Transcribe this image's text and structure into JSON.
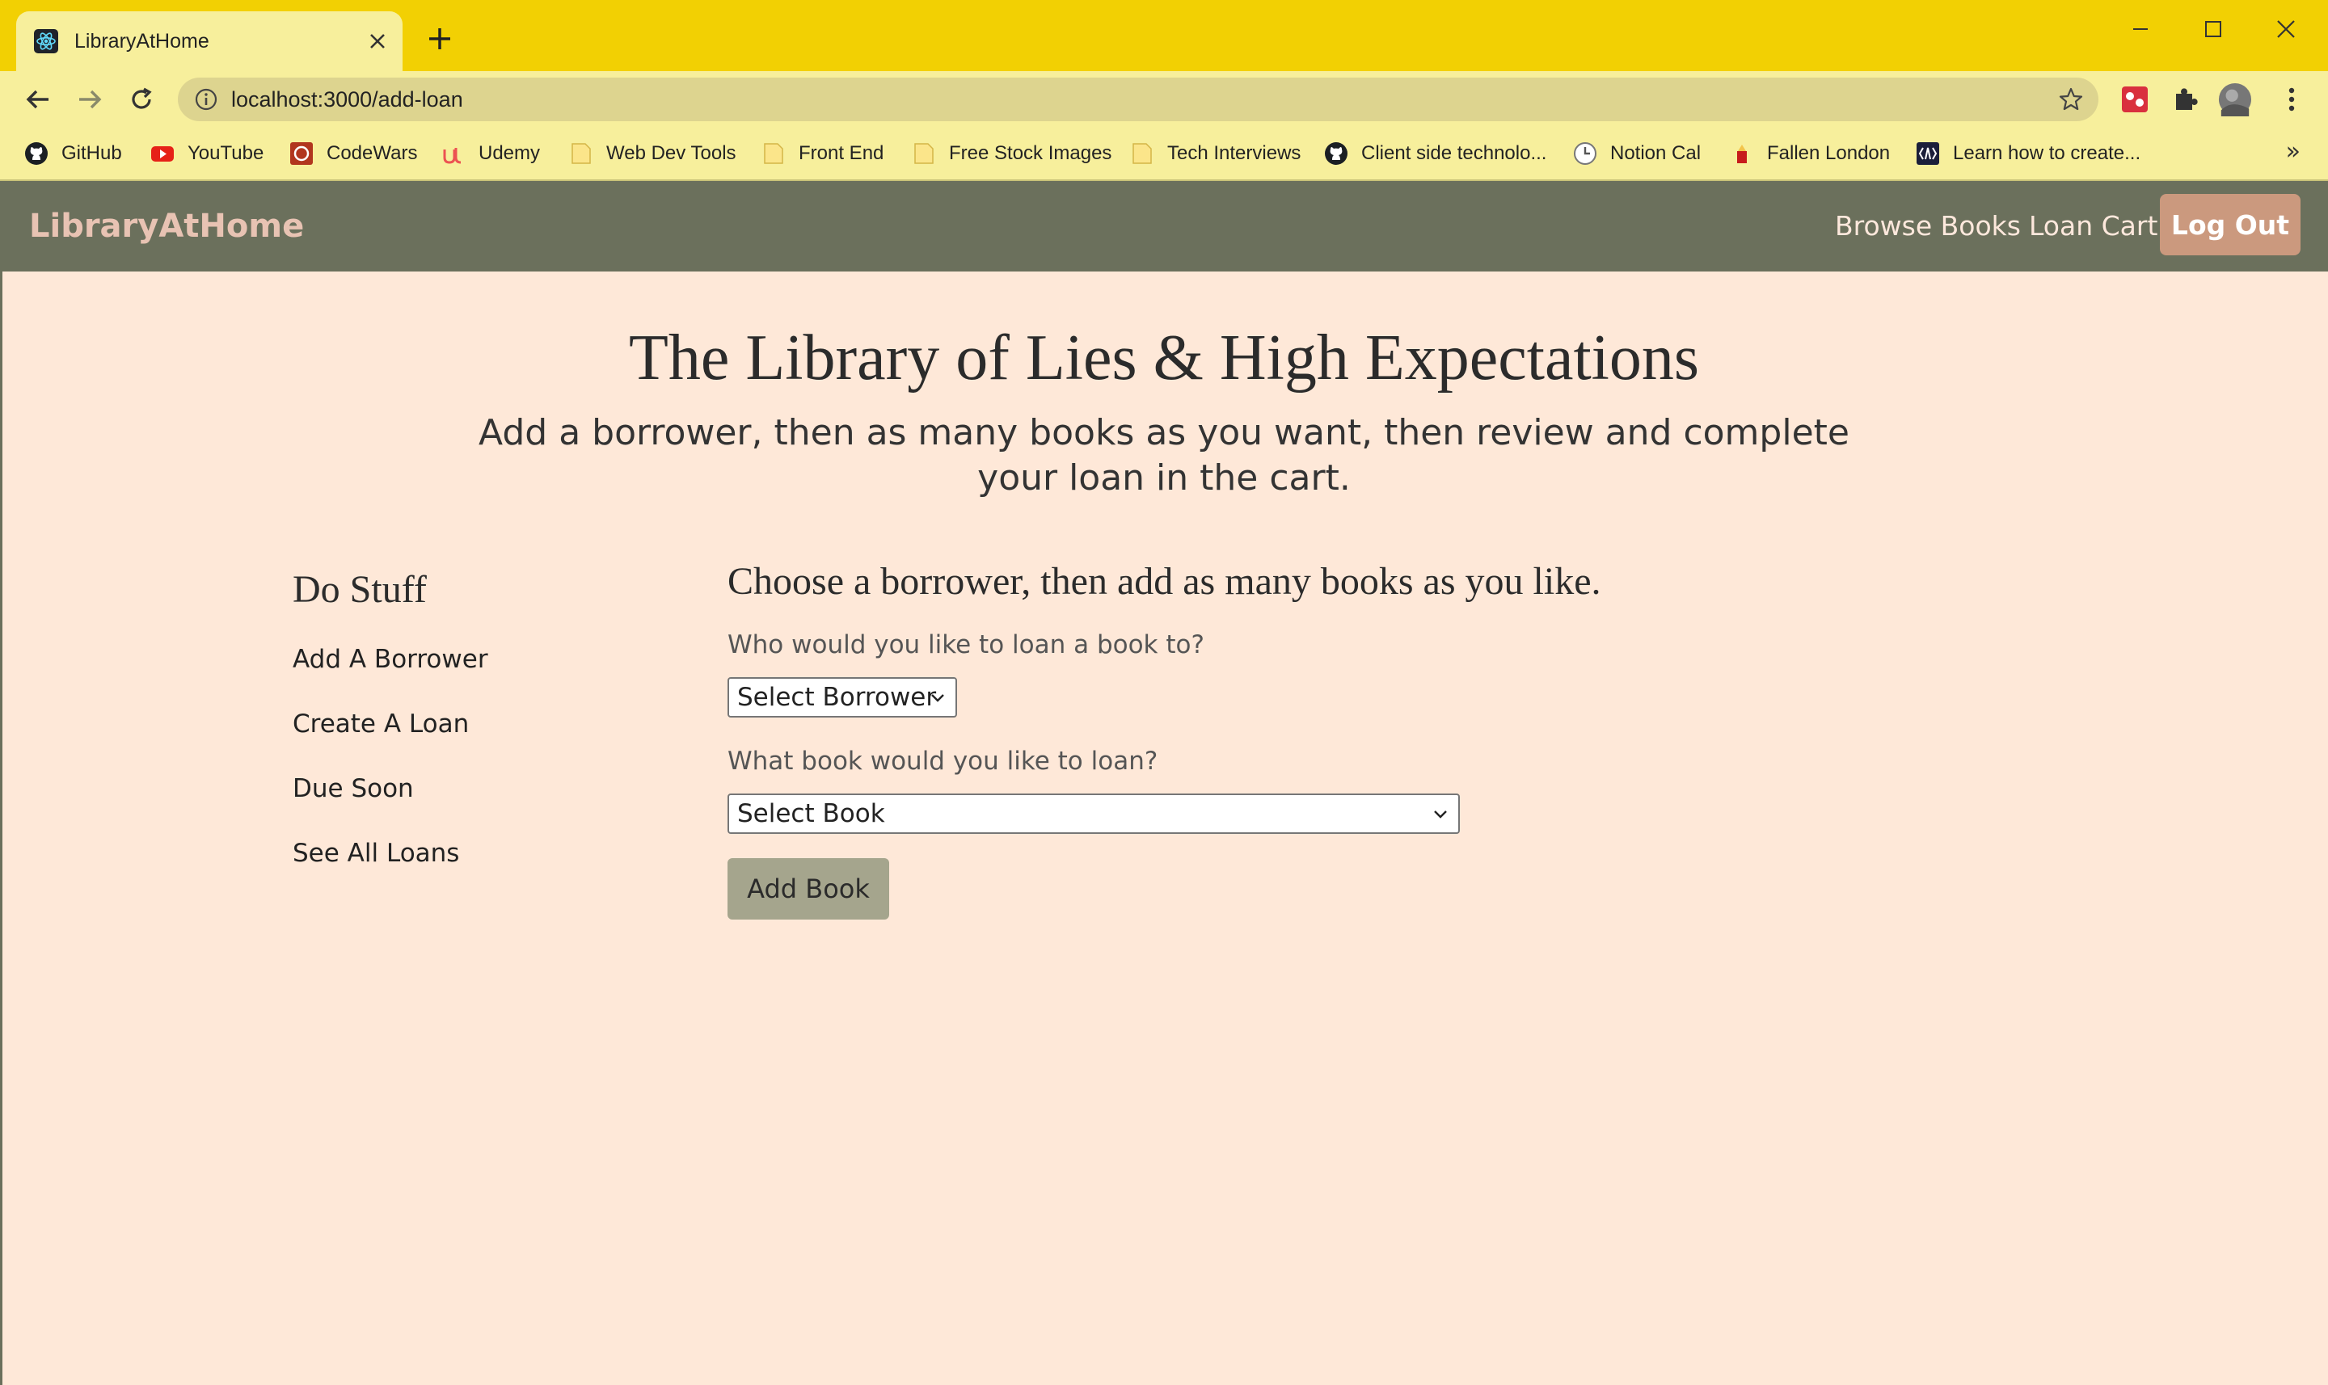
{
  "browser": {
    "tab_title": "LibraryAtHome",
    "url": "localhost:3000/add-loan",
    "bookmarks": [
      {
        "label": "GitHub",
        "icon": "github-icon"
      },
      {
        "label": "YouTube",
        "icon": "youtube-icon"
      },
      {
        "label": "CodeWars",
        "icon": "codewars-icon"
      },
      {
        "label": "Udemy",
        "icon": "udemy-icon"
      },
      {
        "label": "Web Dev Tools",
        "icon": "folder-icon"
      },
      {
        "label": "Front End",
        "icon": "folder-icon"
      },
      {
        "label": "Free Stock Images",
        "icon": "folder-icon"
      },
      {
        "label": "Tech Interviews",
        "icon": "folder-icon"
      },
      {
        "label": "Client side technolo...",
        "icon": "github-icon"
      },
      {
        "label": "Notion Cal",
        "icon": "clock-icon"
      },
      {
        "label": "Fallen London",
        "icon": "fallen-london-icon"
      },
      {
        "label": "Learn how to create...",
        "icon": "learn-icon"
      }
    ],
    "bookmarks_more": "»"
  },
  "navbar": {
    "brand": "LibraryAtHome",
    "links": [
      "Browse Books",
      "Loan Cart"
    ],
    "logout_label": "Log Out"
  },
  "main": {
    "title": "The Library of Lies & High Expectations",
    "subtitle": "Add a borrower, then as many books as you want, then review and complete your loan in the cart."
  },
  "sidebar": {
    "title": "Do Stuff",
    "items": [
      "Add A Borrower",
      "Create A Loan",
      "Due Soon",
      "See All Loans"
    ]
  },
  "form": {
    "title": "Choose a borrower, then add as many books as you like.",
    "borrower_label": "Who would you like to loan a book to?",
    "borrower_select": "Select Borrower",
    "book_label": "What book would you like to loan?",
    "book_select": "Select Book",
    "add_button": "Add Book"
  },
  "colors": {
    "browser_frame": "#f2d003",
    "navbar": "#6b705c",
    "brand": "#e8c3b3",
    "logout_button": "#cb997e",
    "page_background": "#fee8d8",
    "add_button": "#a5a58d"
  }
}
